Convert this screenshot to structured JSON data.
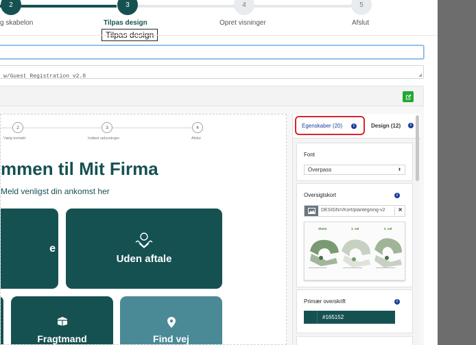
{
  "wizard": {
    "steps": [
      {
        "number": "2",
        "label": "g skabelon",
        "state": "done"
      },
      {
        "number": "3",
        "label": "Tilpas design",
        "state": "active"
      },
      {
        "number": "4",
        "label": "Opret visninger",
        "state": "todo"
      },
      {
        "number": "5",
        "label": "Afslut",
        "state": "todo"
      }
    ],
    "tooltip": "Tilpas design"
  },
  "form": {
    "name_value": "",
    "description_value": "w/Guest Registration v2.0"
  },
  "preview": {
    "steps": [
      {
        "number": "2",
        "label": "Vælg kontakt"
      },
      {
        "number": "3",
        "label": "Indtast oplysninger"
      },
      {
        "number": "4",
        "label": "Afslut"
      }
    ],
    "heading": "mmen til Mit Firma",
    "subheading": "Meld venligst din ankomst her",
    "tiles": [
      {
        "label": "e",
        "icon": "",
        "color": "#165152"
      },
      {
        "label": "Uden aftale",
        "icon": "person-in-box-icon",
        "color": "#165152"
      },
      {
        "label": "",
        "icon": "",
        "color": "#165152"
      },
      {
        "label": "Fragtmand",
        "icon": "package-icon",
        "color": "#165152"
      },
      {
        "label": "Find vej",
        "icon": "map-pin-icon",
        "color": "#4a8a96"
      }
    ]
  },
  "panel": {
    "tab_properties": "Egenskaber (20)",
    "tab_design": "Design (12)",
    "font": {
      "title": "Font",
      "value": "Overpass"
    },
    "overview_map": {
      "title": "Oversigtskort",
      "file_value": "DESIGN=/Kort/plantegning-v2",
      "map_labels": [
        "Stuen",
        "1. sal",
        "2. sal"
      ]
    },
    "primary_heading": {
      "title": "Primær overskrift",
      "color_value": "#165152"
    }
  },
  "colors": {
    "brand": "#165152",
    "highlight": "#d9232f",
    "info": "#1d3d9b",
    "green": "#22a832"
  }
}
